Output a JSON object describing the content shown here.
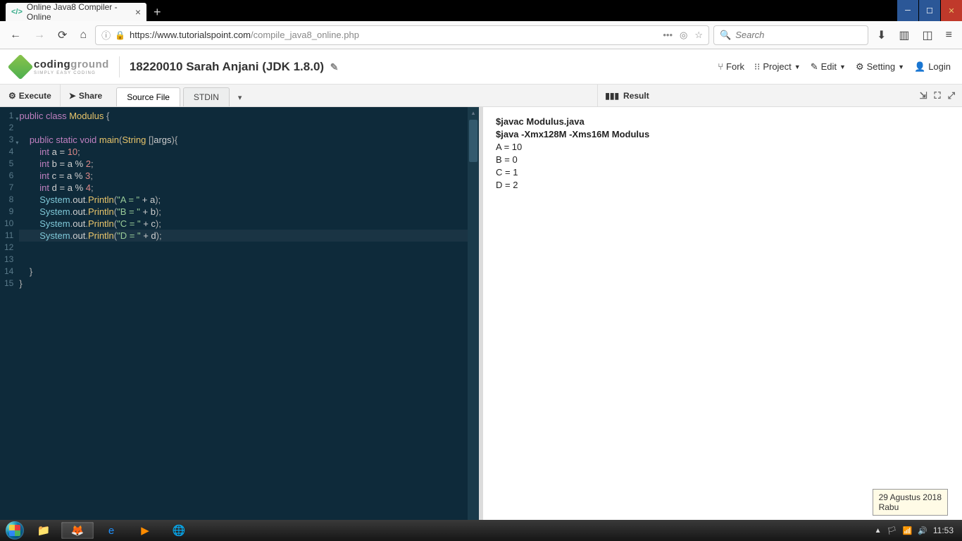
{
  "browser": {
    "tab_title": "Online Java8 Compiler - Online",
    "url": "https://www.tutorialspoint.com/compile_java8_online.php",
    "search_placeholder": "Search"
  },
  "header": {
    "logo_main": "coding",
    "logo_accent": "ground",
    "logo_sub": "SIMPLY EASY CODING",
    "project_title": "18220010 Sarah Anjani (JDK 1.8.0)",
    "links": {
      "fork": "Fork",
      "project": "Project",
      "edit": "Edit",
      "setting": "Setting",
      "login": "Login"
    }
  },
  "toolbar": {
    "execute": "Execute",
    "share": "Share",
    "tab_source": "Source File",
    "tab_stdin": "STDIN",
    "result": "Result"
  },
  "code_lines": [
    {
      "n": 1,
      "fold": true,
      "h": "<span class='kw'>public</span> <span class='kw'>class</span> <span class='cls'>Modulus</span> <span class='pn'>{</span>"
    },
    {
      "n": 2,
      "h": ""
    },
    {
      "n": 3,
      "fold": true,
      "h": "    <span class='kw'>public</span> <span class='kw'>static</span> <span class='ty'>void</span> <span class='fn'>main</span><span class='pn'>(</span><span class='cls'>String</span> <span class='pn'>[]</span><span class='id'>args</span><span class='pn'>){</span>"
    },
    {
      "n": 4,
      "h": "        <span class='ty'>int</span> <span class='id'>a</span> <span class='op'>=</span> <span class='num'>10</span><span class='pn'>;</span>"
    },
    {
      "n": 5,
      "h": "        <span class='ty'>int</span> <span class='id'>b</span> <span class='op'>=</span> <span class='id'>a</span> <span class='op'>%</span> <span class='num'>2</span><span class='pn'>;</span>"
    },
    {
      "n": 6,
      "h": "        <span class='ty'>int</span> <span class='id'>c</span> <span class='op'>=</span> <span class='id'>a</span> <span class='op'>%</span> <span class='num'>3</span><span class='pn'>;</span>"
    },
    {
      "n": 7,
      "h": "        <span class='ty'>int</span> <span class='id'>d</span> <span class='op'>=</span> <span class='id'>a</span> <span class='op'>%</span> <span class='num'>4</span><span class='pn'>;</span>"
    },
    {
      "n": 8,
      "h": "        <span class='sys'>System</span><span class='pn'>.</span><span class='id'>out</span><span class='pn'>.</span><span class='fn'>Println</span><span class='pn'>(</span><span class='str'>\"A = \"</span> <span class='op'>+</span> <span class='id'>a</span><span class='pn'>);</span>"
    },
    {
      "n": 9,
      "h": "        <span class='sys'>System</span><span class='pn'>.</span><span class='id'>out</span><span class='pn'>.</span><span class='fn'>Println</span><span class='pn'>(</span><span class='str'>\"B = \"</span> <span class='op'>+</span> <span class='id'>b</span><span class='pn'>);</span>"
    },
    {
      "n": 10,
      "h": "        <span class='sys'>System</span><span class='pn'>.</span><span class='id'>out</span><span class='pn'>.</span><span class='fn'>Println</span><span class='pn'>(</span><span class='str'>\"C = \"</span> <span class='op'>+</span> <span class='id'>c</span><span class='pn'>);</span>"
    },
    {
      "n": 11,
      "hl": true,
      "h": "        <span class='sys'>System</span><span class='pn'>.</span><span class='id'>out</span><span class='pn'>.</span><span class='fn'>Println</span><span class='pn'>(</span><span class='str'>\"D = \"</span> <span class='op'>+</span> <span class='id'>d</span><span class='pn'>);</span>"
    },
    {
      "n": 12,
      "h": "        "
    },
    {
      "n": 13,
      "h": "        "
    },
    {
      "n": 14,
      "h": "    <span class='pn'>}</span>"
    },
    {
      "n": 15,
      "h": "<span class='pn'>}</span>"
    }
  ],
  "result": {
    "lines": [
      {
        "bold": true,
        "t": "$javac Modulus.java"
      },
      {
        "bold": true,
        "t": "$java -Xmx128M -Xms16M Modulus"
      },
      {
        "t": "A = 10"
      },
      {
        "t": "B = 0"
      },
      {
        "t": "C = 1"
      },
      {
        "t": "D = 2"
      }
    ]
  },
  "tooltip": {
    "line1": "29 Agustus 2018",
    "line2": "Rabu"
  },
  "taskbar": {
    "clock": "11:53"
  }
}
